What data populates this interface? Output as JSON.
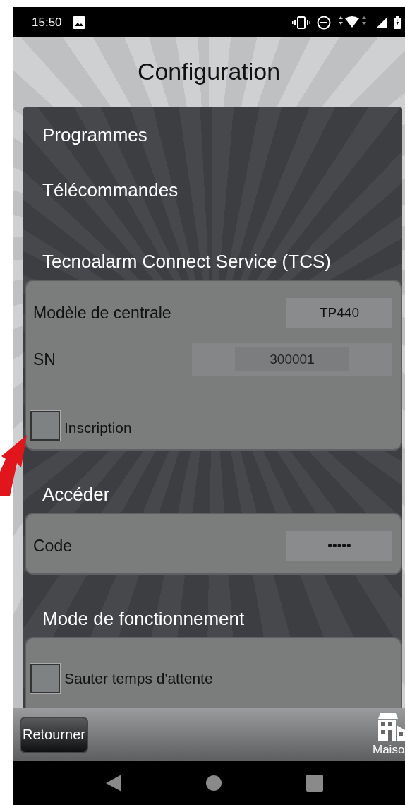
{
  "status_bar": {
    "time": "15:50"
  },
  "title": "Configuration",
  "menu": [
    {
      "label": "Programmes"
    },
    {
      "label": "Télécommandes"
    }
  ],
  "sections": [
    {
      "heading": "Tecnoalarm Connect Service (TCS)",
      "rows": [
        {
          "kind": "field",
          "label": "Modèle de centrale",
          "value": "TP440"
        },
        {
          "kind": "wide_field",
          "label": "SN",
          "value": "300001"
        },
        {
          "kind": "checkbox",
          "label": "Inscription",
          "checked": false
        }
      ]
    },
    {
      "heading": "Accéder",
      "rows": [
        {
          "kind": "field",
          "label": "Code",
          "value": "•••••"
        }
      ]
    },
    {
      "heading": "Mode de fonctionnement",
      "rows": [
        {
          "kind": "checkbox",
          "label": "Sauter temps d'attente",
          "checked": false
        }
      ]
    }
  ],
  "bottom_bar": {
    "back": "Retourner",
    "home": "Maiso"
  }
}
